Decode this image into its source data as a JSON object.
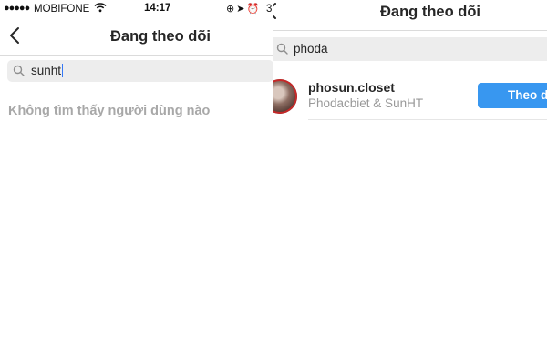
{
  "left": {
    "status_bar": {
      "signal_dots": "●●●●●",
      "carrier": "MOBIFONE",
      "time": "14:17",
      "battery_text": "3"
    },
    "header": {
      "title": "Đang theo dõi"
    },
    "search": {
      "query": "sunht"
    },
    "empty_message": "Không tìm thấy người dùng nào"
  },
  "right": {
    "header": {
      "title": "Đang theo dõi"
    },
    "search": {
      "query": "phoda"
    },
    "results": [
      {
        "username": "phosun.closet",
        "full_name": "Phodacbiet & SunHT",
        "button_label": "Theo d"
      }
    ]
  },
  "colors": {
    "accent": "#3897f0",
    "muted_text": "#a8a8a8",
    "search_bg": "#ededed"
  },
  "icons": [
    "back-icon",
    "search-icon",
    "wifi-icon",
    "location-arrow-icon",
    "alarm-icon",
    "lock-rotation-icon"
  ]
}
